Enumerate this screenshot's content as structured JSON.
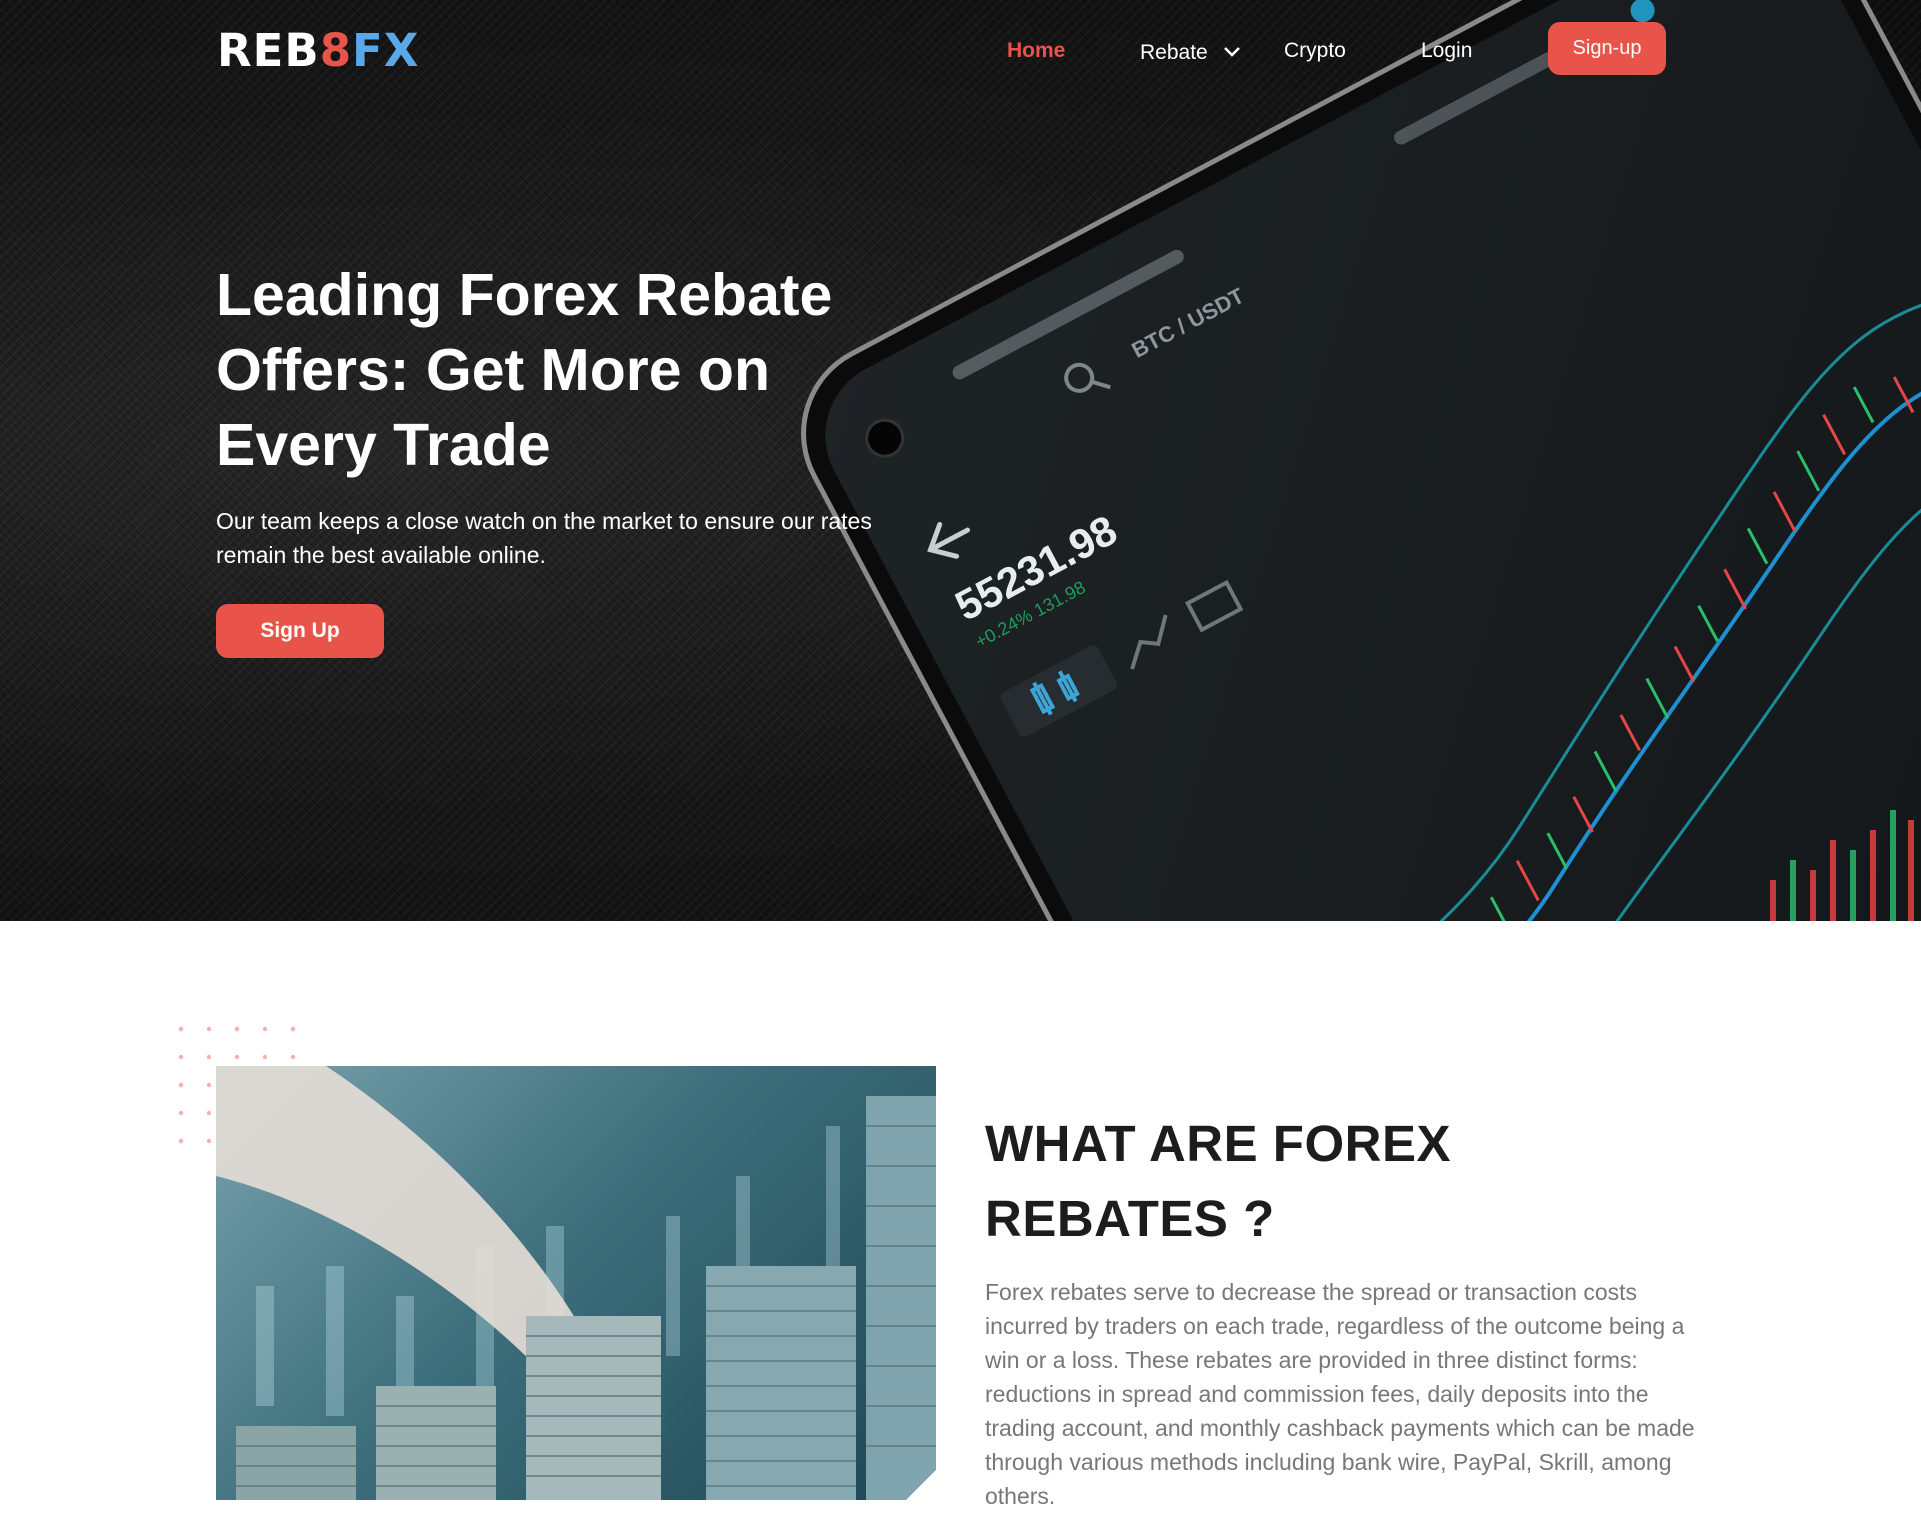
{
  "nav": {
    "logo": {
      "part1": "REB",
      "part2": "8",
      "part3": "FX"
    },
    "items": [
      {
        "label": "Home",
        "active": true
      },
      {
        "label": "Rebate",
        "has_dropdown": true
      },
      {
        "label": "Crypto"
      },
      {
        "label": "Login"
      }
    ],
    "signup_label": "Sign-up"
  },
  "hero": {
    "title": "Leading Forex Rebate Offers: Get More on Every Trade",
    "subtitle": "Our team keeps a close watch on the market to ensure our rates remain the best available online.",
    "cta_label": "Sign Up",
    "phone": {
      "price": "55231.98",
      "change": "+0.24%  131.98",
      "pair": "BTC / USDT"
    }
  },
  "about": {
    "title": "WHAT ARE FOREX REBATES ?",
    "text": "Forex rebates serve to decrease the spread or transaction costs incurred by traders on each trade, regardless of the outcome being a win or a loss. These rebates are provided in three distinct forms: reductions in spread and commission fees, daily deposits into the trading account, and monthly cashback payments which can be made through various methods including bank wire, PayPal, Skrill, among others."
  },
  "colors": {
    "accent": "#e8544a",
    "logo_blue": "#5aa8e8",
    "hero_bg": "#161616",
    "body_text": "#777777",
    "heading": "#1d1d1d"
  },
  "icons": [
    "chevron-down-icon",
    "back-arrow-icon",
    "search-icon",
    "candlestick-icon",
    "line-chart-icon"
  ]
}
